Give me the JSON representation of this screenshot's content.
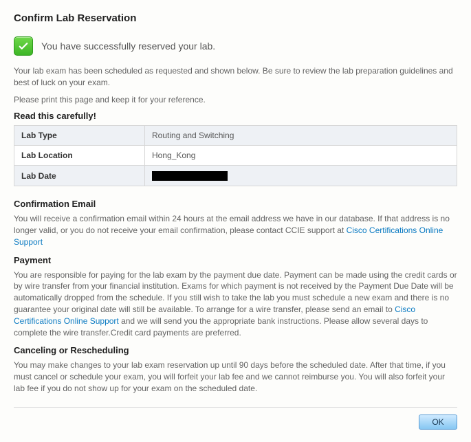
{
  "title": "Confirm Lab Reservation",
  "success_message": "You have successfully reserved your lab.",
  "intro_1": "Your lab exam has been scheduled as requested and shown below. Be sure to review the lab preparation guidelines and best of luck on your exam.",
  "intro_2": "Please print this page and keep it for your reference.",
  "read_carefully": "Read this carefully!",
  "details": {
    "rows": [
      {
        "label": "Lab Type",
        "value": "Routing and Switching"
      },
      {
        "label": "Lab Location",
        "value": "Hong_Kong"
      },
      {
        "label": "Lab Date",
        "value": ""
      }
    ]
  },
  "sections": {
    "confirmation": {
      "heading": "Confirmation Email",
      "text_before_link": "You will receive a confirmation email within 24 hours at the email address we have in our database. If that address is no longer valid, or you do not receive your email confirmation, please contact CCIE support at ",
      "link_text": "Cisco Certifications Online Support"
    },
    "payment": {
      "heading": "Payment",
      "text_before_link": "You are responsible for paying for the lab exam by the payment due date. Payment can be made using the credit cards or by wire transfer from your financial institution. Exams for which payment is not received by the Payment Due Date will be automatically dropped from the schedule. If you still wish to take the lab you must schedule a new exam and there is no guarantee your original date will still be available. To arrange for a wire transfer, please send an email to ",
      "link_text": "Cisco Certifications Online Support",
      "text_after_link": " and we will send you the appropriate bank instructions. Please allow several days to complete the wire transfer.Credit card payments are preferred."
    },
    "cancel": {
      "heading": "Canceling or Rescheduling",
      "text": "You may make changes to your lab exam reservation up until 90 days before the scheduled date. After that time, if you must cancel or schedule your exam, you will forfeit your lab fee and we cannot reimburse you. You will also forfeit your lab fee if you do not show up for your exam on the scheduled date."
    }
  },
  "ok_label": "OK"
}
